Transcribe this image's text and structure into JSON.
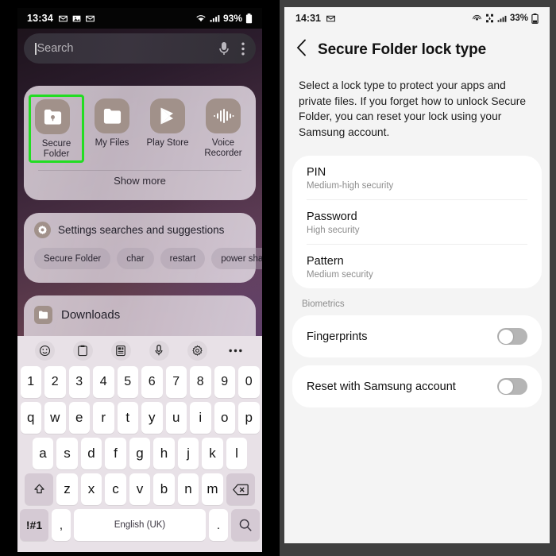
{
  "left": {
    "status": {
      "time": "13:34",
      "icons_left": [
        "mail-icon",
        "photo-icon",
        "mail-icon"
      ],
      "wifi_icon": "wifi-icon",
      "signal_icon": "signal-bars-icon",
      "battery_text": "93%",
      "battery_icon": "battery-icon"
    },
    "search": {
      "placeholder": "Search",
      "mic_icon": "microphone-icon",
      "more_icon": "overflow-menu-icon"
    },
    "apps_card": {
      "apps": [
        {
          "label": "Secure Folder",
          "icon": "secure-folder-icon",
          "highlighted": true
        },
        {
          "label": "My Files",
          "icon": "folder-icon",
          "highlighted": false
        },
        {
          "label": "Play Store",
          "icon": "play-store-icon",
          "highlighted": false
        },
        {
          "label": "Voice Recorder",
          "icon": "voice-recorder-icon",
          "highlighted": false
        }
      ],
      "show_more": "Show more",
      "highlight_color": "#22dd22"
    },
    "suggestions_card": {
      "icon": "settings-gear-icon",
      "title": "Settings searches and suggestions",
      "chips": [
        "Secure Folder",
        "char",
        "restart",
        "power shari"
      ]
    },
    "downloads_card": {
      "icon": "folder-icon",
      "title": "Downloads"
    },
    "keyboard": {
      "toolbar": [
        "emoji-icon",
        "clipboard-icon",
        "sticker-icon",
        "microphone-icon",
        "settings-gear-icon",
        "more-options-icon"
      ],
      "row_numbers": [
        "1",
        "2",
        "3",
        "4",
        "5",
        "6",
        "7",
        "8",
        "9",
        "0"
      ],
      "row_top": [
        "q",
        "w",
        "e",
        "r",
        "t",
        "y",
        "u",
        "i",
        "o",
        "p"
      ],
      "row_home": [
        "a",
        "s",
        "d",
        "f",
        "g",
        "h",
        "j",
        "k",
        "l"
      ],
      "row_bottom": [
        "z",
        "x",
        "c",
        "v",
        "b",
        "n",
        "m"
      ],
      "shift_icon": "shift-arrow-icon",
      "delete_icon": "backspace-icon",
      "symbols_key": "!#1",
      "comma_key": ",",
      "space_key": "English (UK)",
      "period_key": ".",
      "search_icon": "search-icon"
    }
  },
  "right": {
    "status": {
      "time": "14:31",
      "icons_left": [
        "mail-icon"
      ],
      "icons_right": [
        "hotspot-icon",
        "data-saver-icon",
        "signal-bars-icon"
      ],
      "battery_text": "33%",
      "battery_icon": "battery-low-icon"
    },
    "header": {
      "back_icon": "back-chevron-icon",
      "title": "Secure Folder lock type"
    },
    "description": "Select a lock type to protect your apps and private files. If you forget how to unlock Secure Folder, you can reset your lock using your Samsung account.",
    "lock_types": [
      {
        "title": "PIN",
        "subtitle": "Medium-high security"
      },
      {
        "title": "Password",
        "subtitle": "High security"
      },
      {
        "title": "Pattern",
        "subtitle": "Medium security"
      }
    ],
    "biometrics_header": "Biometrics",
    "biometrics": [
      {
        "label": "Fingerprints",
        "enabled": false
      }
    ],
    "reset": [
      {
        "label": "Reset with Samsung account",
        "enabled": false
      }
    ]
  }
}
